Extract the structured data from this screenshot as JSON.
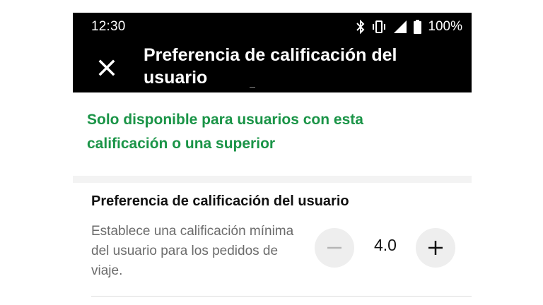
{
  "status_bar": {
    "time": "12:30",
    "battery": "100%",
    "icons": [
      "bluetooth-icon",
      "vibrate-icon",
      "signal-icon",
      "battery-icon"
    ]
  },
  "app_bar": {
    "title": "Preferencia de calificación del usuario",
    "close_icon": "close-icon"
  },
  "notice": {
    "text": "Solo disponible para usuarios con esta calificación o una superior"
  },
  "preference": {
    "title": "Preferencia de calificación del usuario",
    "description": "Establece una calificación mínima del usuario para los pedidos de viaje.",
    "value": "4.0",
    "minus_icon": "minus-icon",
    "plus_icon": "plus-icon"
  },
  "colors": {
    "accent_green": "#1a9447",
    "header_bg": "#000000",
    "stepper_bg": "#eeeeee"
  }
}
